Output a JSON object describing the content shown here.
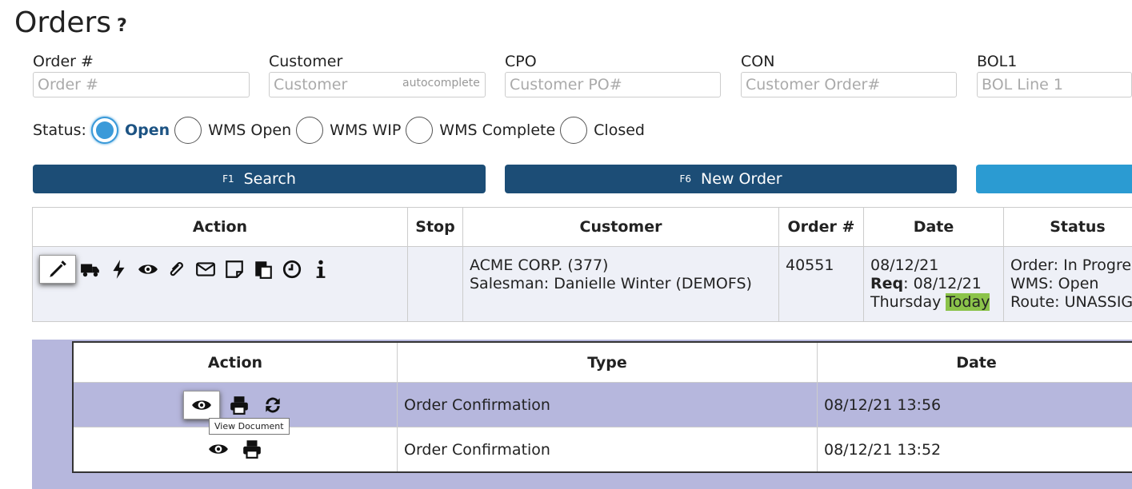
{
  "page": {
    "title": "Orders",
    "help": "?"
  },
  "filters": {
    "order": {
      "label": "Order #",
      "placeholder": "Order #"
    },
    "customer": {
      "label": "Customer",
      "placeholder": "Customer",
      "hint": "autocomplete"
    },
    "cpo": {
      "label": "CPO",
      "placeholder": "Customer PO#"
    },
    "con": {
      "label": "CON",
      "placeholder": "Customer Order#"
    },
    "bol1": {
      "label": "BOL1",
      "placeholder": "BOL Line 1"
    }
  },
  "status": {
    "label": "Status:",
    "options": [
      "Open",
      "WMS Open",
      "WMS WIP",
      "WMS Complete",
      "Closed"
    ],
    "selected": "Open"
  },
  "buttons": {
    "search": {
      "key": "F1",
      "label": "Search"
    },
    "new_order": {
      "key": "F6",
      "label": "New Order"
    }
  },
  "orders_table": {
    "headers": [
      "Action",
      "Stop",
      "Customer",
      "Order #",
      "Date",
      "Status"
    ],
    "row": {
      "action_icons": [
        "pencil-icon",
        "truck-icon",
        "bolt-icon",
        "eye-icon",
        "paperclip-icon",
        "envelope-icon",
        "note-icon",
        "clipboard-icon",
        "clock-icon",
        "info-icon"
      ],
      "stop": "",
      "customer_line1": "ACME CORP. (377)",
      "customer_line2": "Salesman: Danielle Winter (DEMOFS)",
      "order_no": "40551",
      "date_line1": "08/12/21",
      "req_label": "Req",
      "req_value": ": 08/12/21",
      "weekday": "Thursday",
      "today": "Today",
      "status_line1": "Order: In Progres",
      "status_line2": "WMS: Open",
      "status_line3": "Route: UNASSIG"
    }
  },
  "docs_table": {
    "headers": [
      "Action",
      "Type",
      "Date"
    ],
    "rows": [
      {
        "type": "Order Confirmation",
        "date": "08/12/21 13:56",
        "icons": [
          "eye-icon",
          "printer-icon",
          "refresh-icon"
        ]
      },
      {
        "type": "Order Confirmation",
        "date": "08/12/21 13:52",
        "icons": [
          "eye-icon",
          "printer-icon"
        ]
      }
    ],
    "tooltip": "View Document"
  },
  "colors": {
    "primary": "#1c4d76",
    "accent": "#3a9ad9",
    "highlight": "#b6b7dd",
    "today": "#8bc34a"
  }
}
